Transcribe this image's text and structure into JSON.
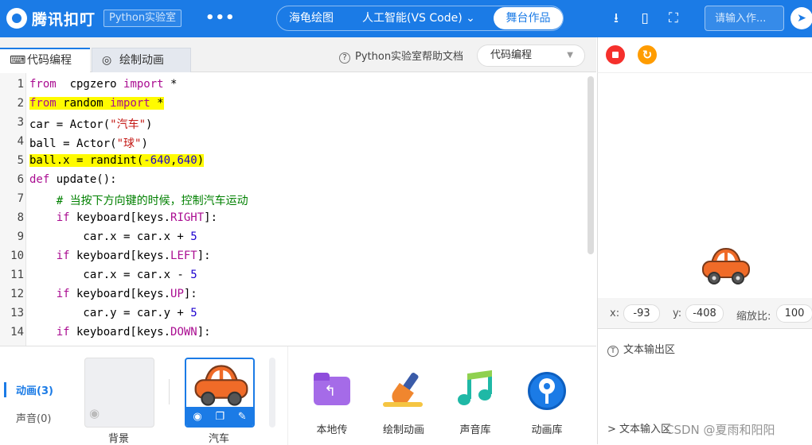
{
  "header": {
    "logo_text": "腾讯扣叮",
    "lab_badge": "Python实验室",
    "more_label": "•••",
    "modes": {
      "turtle": "海龟绘图",
      "ai": "人工智能(VS Code)",
      "stage": "舞台作品"
    },
    "search_placeholder": "请输入作..."
  },
  "editor": {
    "tabs": {
      "code": "代码编程",
      "anim": "绘制动画"
    },
    "help": "Python实验室帮助文档",
    "mode_select": "代码编程"
  },
  "code_lines": [
    {
      "n": "1",
      "parts": [
        [
          "kw",
          "from"
        ],
        [
          "",
          "  cpgzero "
        ],
        [
          "kw",
          "import"
        ],
        [
          "",
          " *"
        ]
      ]
    },
    {
      "n": "2",
      "parts": [
        [
          "kw",
          "from"
        ],
        [
          "",
          " random "
        ],
        [
          "kw",
          "import"
        ],
        [
          "",
          " *"
        ]
      ],
      "highlight": true
    },
    {
      "n": "3",
      "parts": [
        [
          "",
          "car = Actor("
        ],
        [
          "str",
          "\"汽车\""
        ],
        [
          "",
          ")"
        ]
      ]
    },
    {
      "n": "4",
      "parts": [
        [
          "",
          "ball = Actor("
        ],
        [
          "str",
          "\"球\""
        ],
        [
          "",
          ")"
        ]
      ]
    },
    {
      "n": "5",
      "parts": [
        [
          "",
          "ball.x = randint("
        ],
        [
          "num",
          "-640"
        ],
        [
          "",
          ","
        ],
        [
          "num",
          "640"
        ],
        [
          "",
          ")"
        ]
      ],
      "highlight": true
    },
    {
      "n": "6",
      "parts": [
        [
          "kw",
          "def"
        ],
        [
          "",
          " update():"
        ]
      ]
    },
    {
      "n": "7",
      "parts": [
        [
          "",
          "    "
        ],
        [
          "cm",
          "# 当按下方向键的时候，控制汽车运动"
        ]
      ]
    },
    {
      "n": "8",
      "parts": [
        [
          "",
          "    "
        ],
        [
          "kw",
          "if"
        ],
        [
          "",
          " keyboard[keys."
        ],
        [
          "kw",
          "RIGHT"
        ],
        [
          "",
          "]:"
        ]
      ]
    },
    {
      "n": "9",
      "parts": [
        [
          "",
          "        car.x = car.x + "
        ],
        [
          "num",
          "5"
        ]
      ]
    },
    {
      "n": "10",
      "parts": [
        [
          "",
          "    "
        ],
        [
          "kw",
          "if"
        ],
        [
          "",
          " keyboard[keys."
        ],
        [
          "kw",
          "LEFT"
        ],
        [
          "",
          "]:"
        ]
      ]
    },
    {
      "n": "11",
      "parts": [
        [
          "",
          "        car.x = car.x - "
        ],
        [
          "num",
          "5"
        ]
      ]
    },
    {
      "n": "12",
      "parts": [
        [
          "",
          "    "
        ],
        [
          "kw",
          "if"
        ],
        [
          "",
          " keyboard[keys."
        ],
        [
          "kw",
          "UP"
        ],
        [
          "",
          "]:"
        ]
      ]
    },
    {
      "n": "13",
      "parts": [
        [
          "",
          "        car.y = car.y + "
        ],
        [
          "num",
          "5"
        ]
      ]
    },
    {
      "n": "14",
      "parts": [
        [
          "",
          "    "
        ],
        [
          "kw",
          "if"
        ],
        [
          "",
          " keyboard[keys."
        ],
        [
          "kw",
          "DOWN"
        ],
        [
          "",
          "]:"
        ]
      ]
    }
  ],
  "stage": {
    "x_label": "x:",
    "x_value": "-93",
    "y_label": "y:",
    "y_value": "-408",
    "scale_label": "缩放比:",
    "scale_value": "100",
    "output_title": "文本输出区",
    "input_label": "> 文本输入区",
    "watermark": "CSDN @夏雨和阳阳"
  },
  "bottom": {
    "side_tabs": {
      "anim": "动画(3)",
      "sound": "声音(0)"
    },
    "cards": {
      "bg": "背景",
      "car": "汽车"
    },
    "tools": {
      "local": "本地传",
      "draw": "绘制动画",
      "sound_lib": "声音库",
      "anim_lib": "动画库"
    }
  }
}
